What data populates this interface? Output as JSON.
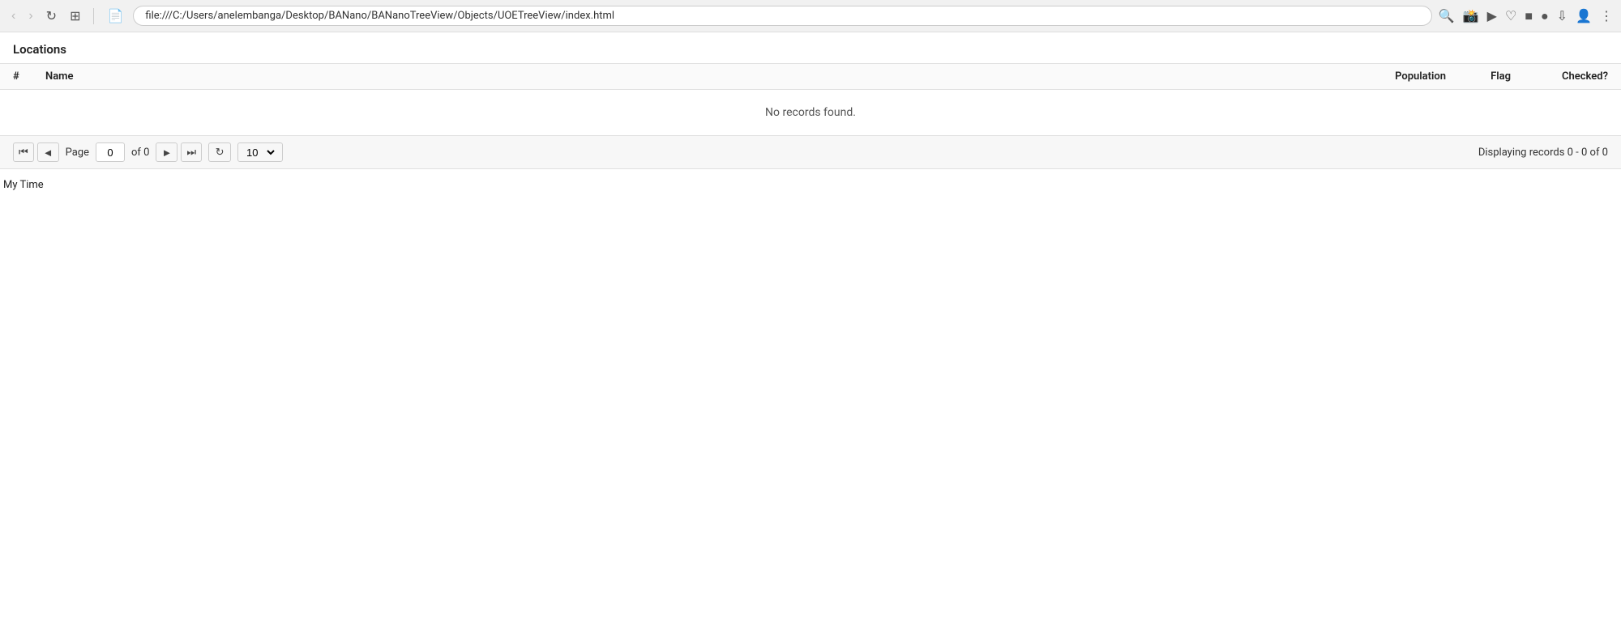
{
  "browser": {
    "url": "file:///C:/Users/anelembanga/Desktop/BANano/BANanoTreeView/Objects/UOETreeView/index.html",
    "back_btn": "‹",
    "forward_btn": "›",
    "reload_btn": "↻",
    "tabs_btn": "⊞",
    "doc_icon": "🗎"
  },
  "page": {
    "title": "Locations",
    "table": {
      "columns": {
        "hash": "#",
        "name": "Name",
        "population": "Population",
        "flag": "Flag",
        "checked": "Checked?"
      },
      "no_records_message": "No records found."
    },
    "pagination": {
      "page_label": "Page",
      "page_value": "0",
      "of_label": "of 0",
      "per_page_value": "10",
      "displaying_label": "Displaying records  0 - 0 of 0"
    },
    "footer_label": "My Time"
  }
}
